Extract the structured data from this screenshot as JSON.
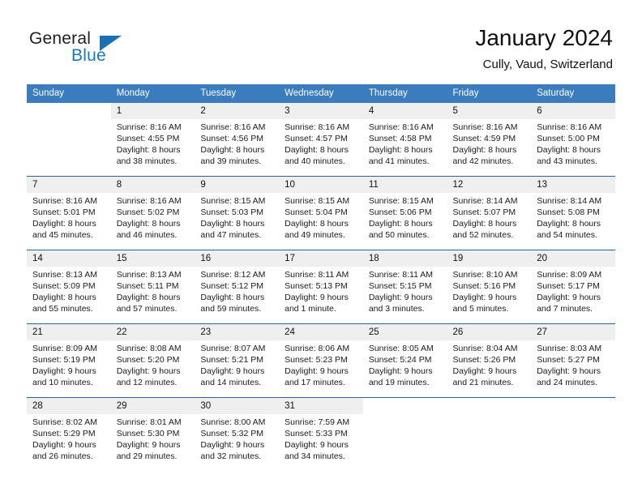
{
  "brand": {
    "line1": "General",
    "line2": "Blue",
    "triangle_color": "#1a6fb5",
    "text_color": "#231f20",
    "accent_color": "#1878c0"
  },
  "header": {
    "title": "January 2024",
    "subtitle": "Cully, Vaud, Switzerland"
  },
  "theme": {
    "header_row_bg": "#3a7cbd",
    "week_separator": "#2f6399",
    "day_number_bg": "#efefef",
    "page_bg": "#ffffff"
  },
  "calendar": {
    "weekday_headers": [
      "Sunday",
      "Monday",
      "Tuesday",
      "Wednesday",
      "Thursday",
      "Friday",
      "Saturday"
    ],
    "labels": {
      "sunrise": "Sunrise:",
      "sunset": "Sunset:",
      "daylight": "Daylight:"
    },
    "weeks": [
      [
        {
          "empty": true
        },
        {
          "day": "1",
          "sunrise": "Sunrise: 8:16 AM",
          "sunset": "Sunset: 4:55 PM",
          "daylight_1": "Daylight: 8 hours",
          "daylight_2": "and 38 minutes."
        },
        {
          "day": "2",
          "sunrise": "Sunrise: 8:16 AM",
          "sunset": "Sunset: 4:56 PM",
          "daylight_1": "Daylight: 8 hours",
          "daylight_2": "and 39 minutes."
        },
        {
          "day": "3",
          "sunrise": "Sunrise: 8:16 AM",
          "sunset": "Sunset: 4:57 PM",
          "daylight_1": "Daylight: 8 hours",
          "daylight_2": "and 40 minutes."
        },
        {
          "day": "4",
          "sunrise": "Sunrise: 8:16 AM",
          "sunset": "Sunset: 4:58 PM",
          "daylight_1": "Daylight: 8 hours",
          "daylight_2": "and 41 minutes."
        },
        {
          "day": "5",
          "sunrise": "Sunrise: 8:16 AM",
          "sunset": "Sunset: 4:59 PM",
          "daylight_1": "Daylight: 8 hours",
          "daylight_2": "and 42 minutes."
        },
        {
          "day": "6",
          "sunrise": "Sunrise: 8:16 AM",
          "sunset": "Sunset: 5:00 PM",
          "daylight_1": "Daylight: 8 hours",
          "daylight_2": "and 43 minutes."
        }
      ],
      [
        {
          "day": "7",
          "sunrise": "Sunrise: 8:16 AM",
          "sunset": "Sunset: 5:01 PM",
          "daylight_1": "Daylight: 8 hours",
          "daylight_2": "and 45 minutes."
        },
        {
          "day": "8",
          "sunrise": "Sunrise: 8:16 AM",
          "sunset": "Sunset: 5:02 PM",
          "daylight_1": "Daylight: 8 hours",
          "daylight_2": "and 46 minutes."
        },
        {
          "day": "9",
          "sunrise": "Sunrise: 8:15 AM",
          "sunset": "Sunset: 5:03 PM",
          "daylight_1": "Daylight: 8 hours",
          "daylight_2": "and 47 minutes."
        },
        {
          "day": "10",
          "sunrise": "Sunrise: 8:15 AM",
          "sunset": "Sunset: 5:04 PM",
          "daylight_1": "Daylight: 8 hours",
          "daylight_2": "and 49 minutes."
        },
        {
          "day": "11",
          "sunrise": "Sunrise: 8:15 AM",
          "sunset": "Sunset: 5:06 PM",
          "daylight_1": "Daylight: 8 hours",
          "daylight_2": "and 50 minutes."
        },
        {
          "day": "12",
          "sunrise": "Sunrise: 8:14 AM",
          "sunset": "Sunset: 5:07 PM",
          "daylight_1": "Daylight: 8 hours",
          "daylight_2": "and 52 minutes."
        },
        {
          "day": "13",
          "sunrise": "Sunrise: 8:14 AM",
          "sunset": "Sunset: 5:08 PM",
          "daylight_1": "Daylight: 8 hours",
          "daylight_2": "and 54 minutes."
        }
      ],
      [
        {
          "day": "14",
          "sunrise": "Sunrise: 8:13 AM",
          "sunset": "Sunset: 5:09 PM",
          "daylight_1": "Daylight: 8 hours",
          "daylight_2": "and 55 minutes."
        },
        {
          "day": "15",
          "sunrise": "Sunrise: 8:13 AM",
          "sunset": "Sunset: 5:11 PM",
          "daylight_1": "Daylight: 8 hours",
          "daylight_2": "and 57 minutes."
        },
        {
          "day": "16",
          "sunrise": "Sunrise: 8:12 AM",
          "sunset": "Sunset: 5:12 PM",
          "daylight_1": "Daylight: 8 hours",
          "daylight_2": "and 59 minutes."
        },
        {
          "day": "17",
          "sunrise": "Sunrise: 8:11 AM",
          "sunset": "Sunset: 5:13 PM",
          "daylight_1": "Daylight: 9 hours",
          "daylight_2": "and 1 minute."
        },
        {
          "day": "18",
          "sunrise": "Sunrise: 8:11 AM",
          "sunset": "Sunset: 5:15 PM",
          "daylight_1": "Daylight: 9 hours",
          "daylight_2": "and 3 minutes."
        },
        {
          "day": "19",
          "sunrise": "Sunrise: 8:10 AM",
          "sunset": "Sunset: 5:16 PM",
          "daylight_1": "Daylight: 9 hours",
          "daylight_2": "and 5 minutes."
        },
        {
          "day": "20",
          "sunrise": "Sunrise: 8:09 AM",
          "sunset": "Sunset: 5:17 PM",
          "daylight_1": "Daylight: 9 hours",
          "daylight_2": "and 7 minutes."
        }
      ],
      [
        {
          "day": "21",
          "sunrise": "Sunrise: 8:09 AM",
          "sunset": "Sunset: 5:19 PM",
          "daylight_1": "Daylight: 9 hours",
          "daylight_2": "and 10 minutes."
        },
        {
          "day": "22",
          "sunrise": "Sunrise: 8:08 AM",
          "sunset": "Sunset: 5:20 PM",
          "daylight_1": "Daylight: 9 hours",
          "daylight_2": "and 12 minutes."
        },
        {
          "day": "23",
          "sunrise": "Sunrise: 8:07 AM",
          "sunset": "Sunset: 5:21 PM",
          "daylight_1": "Daylight: 9 hours",
          "daylight_2": "and 14 minutes."
        },
        {
          "day": "24",
          "sunrise": "Sunrise: 8:06 AM",
          "sunset": "Sunset: 5:23 PM",
          "daylight_1": "Daylight: 9 hours",
          "daylight_2": "and 17 minutes."
        },
        {
          "day": "25",
          "sunrise": "Sunrise: 8:05 AM",
          "sunset": "Sunset: 5:24 PM",
          "daylight_1": "Daylight: 9 hours",
          "daylight_2": "and 19 minutes."
        },
        {
          "day": "26",
          "sunrise": "Sunrise: 8:04 AM",
          "sunset": "Sunset: 5:26 PM",
          "daylight_1": "Daylight: 9 hours",
          "daylight_2": "and 21 minutes."
        },
        {
          "day": "27",
          "sunrise": "Sunrise: 8:03 AM",
          "sunset": "Sunset: 5:27 PM",
          "daylight_1": "Daylight: 9 hours",
          "daylight_2": "and 24 minutes."
        }
      ],
      [
        {
          "day": "28",
          "sunrise": "Sunrise: 8:02 AM",
          "sunset": "Sunset: 5:29 PM",
          "daylight_1": "Daylight: 9 hours",
          "daylight_2": "and 26 minutes."
        },
        {
          "day": "29",
          "sunrise": "Sunrise: 8:01 AM",
          "sunset": "Sunset: 5:30 PM",
          "daylight_1": "Daylight: 9 hours",
          "daylight_2": "and 29 minutes."
        },
        {
          "day": "30",
          "sunrise": "Sunrise: 8:00 AM",
          "sunset": "Sunset: 5:32 PM",
          "daylight_1": "Daylight: 9 hours",
          "daylight_2": "and 32 minutes."
        },
        {
          "day": "31",
          "sunrise": "Sunrise: 7:59 AM",
          "sunset": "Sunset: 5:33 PM",
          "daylight_1": "Daylight: 9 hours",
          "daylight_2": "and 34 minutes."
        },
        {
          "empty": true
        },
        {
          "empty": true
        },
        {
          "empty": true
        }
      ]
    ]
  }
}
